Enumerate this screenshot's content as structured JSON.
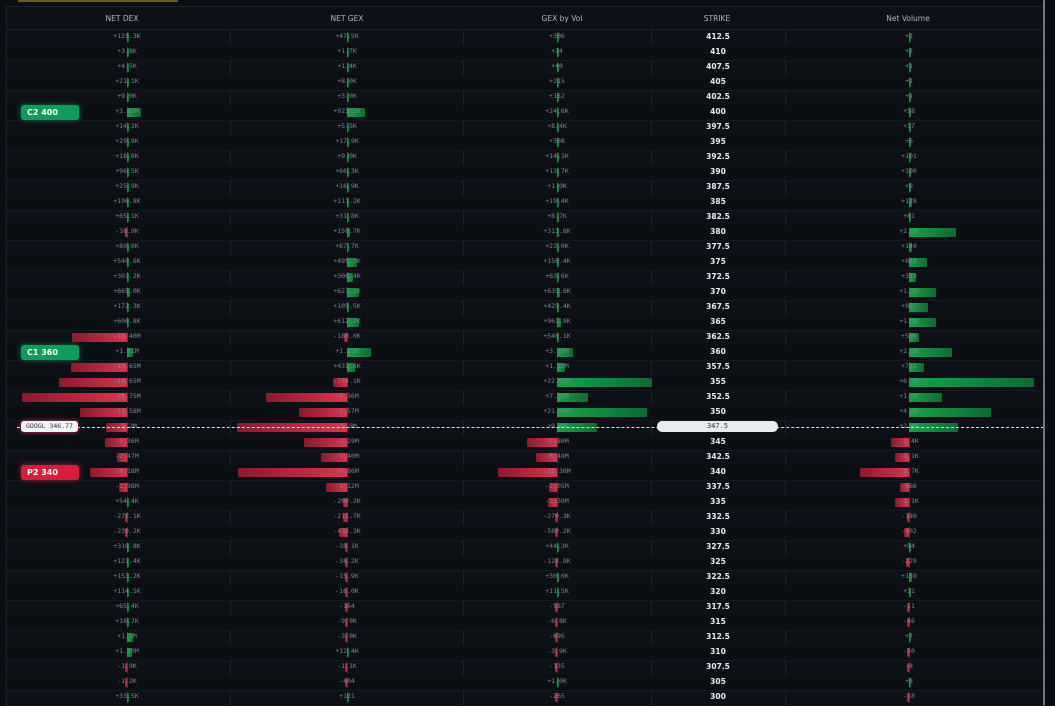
{
  "columns": [
    {
      "key": "dex",
      "label": "NET DEX"
    },
    {
      "key": "gex",
      "label": "NET GEX"
    },
    {
      "key": "gexvol",
      "label": "GEX by Vol"
    },
    {
      "key": "strike",
      "label": "STRIKE"
    },
    {
      "key": "vol",
      "label": "Net Volume"
    }
  ],
  "rows": [
    {
      "strike": "412.5",
      "dex": "+125.3K",
      "gex": "+47.5K",
      "gexvol": "+306",
      "vol": "+2"
    },
    {
      "strike": "410",
      "dex": "+3.8K",
      "gex": "+1.7K",
      "gexvol": "+24",
      "vol": "+2"
    },
    {
      "strike": "407.5",
      "dex": "+4.5K",
      "gex": "+1.4K",
      "gexvol": "+40",
      "vol": "+1"
    },
    {
      "strike": "405",
      "dex": "+21.1K",
      "gex": "+8.0K",
      "gexvol": "+215",
      "vol": "+1"
    },
    {
      "strike": "402.5",
      "dex": "+9.0K",
      "gex": "+3.0K",
      "gexvol": "+152",
      "vol": "+1"
    },
    {
      "strike": "400",
      "dex": "+3.65M",
      "gex": "+923.5K",
      "gexvol": "+24.6K",
      "vol": "+58"
    },
    {
      "strike": "397.5",
      "dex": "+14.3K",
      "gex": "+5.5K",
      "gexvol": "+8.4K",
      "vol": "+37"
    },
    {
      "strike": "395",
      "dex": "+29.9K",
      "gex": "+17.9K",
      "gexvol": "+308",
      "vol": "+6"
    },
    {
      "strike": "392.5",
      "dex": "+18.6K",
      "gex": "+9.0K",
      "gexvol": "+14.1K",
      "vol": "+101"
    },
    {
      "strike": "390",
      "dex": "+96.5K",
      "gex": "+66.3K",
      "gexvol": "+13.7K",
      "vol": "+100"
    },
    {
      "strike": "387.5",
      "dex": "+25.9K",
      "gex": "+16.9K",
      "gexvol": "+1.0K",
      "vol": "+9"
    },
    {
      "strike": "385",
      "dex": "+196.8K",
      "gex": "+111.2K",
      "gexvol": "+19.4K",
      "vol": "+128"
    },
    {
      "strike": "382.5",
      "dex": "+65.1K",
      "gex": "+31.8K",
      "gexvol": "+8.7K",
      "vol": "+81"
    },
    {
      "strike": "380",
      "dex": "-38.9K",
      "gex": "+150.7K",
      "gexvol": "+313.8K",
      "vol": "+2.3K"
    },
    {
      "strike": "377.5",
      "dex": "+80.0K",
      "gex": "+67.7K",
      "gexvol": "+23.0K",
      "vol": "+140"
    },
    {
      "strike": "375",
      "dex": "+540.6K",
      "gex": "+495.3K",
      "gexvol": "+150.4K",
      "vol": "+854"
    },
    {
      "strike": "372.5",
      "dex": "+301.2K",
      "gex": "+300.4K",
      "gexvol": "+63.6K",
      "vol": "+319"
    },
    {
      "strike": "370",
      "dex": "+665.0K",
      "gex": "+627.3K",
      "gexvol": "+635.6K",
      "vol": "+1.3K"
    },
    {
      "strike": "367.5",
      "dex": "+172.3K",
      "gex": "+105.5K",
      "gexvol": "+425.4K",
      "vol": "+937"
    },
    {
      "strike": "365",
      "dex": "+600.8K",
      "gex": "+612.7K",
      "gexvol": "+961.8K",
      "vol": "+1.3K"
    },
    {
      "strike": "362.5",
      "dex": "-13.40M",
      "gex": "-180.0K",
      "gexvol": "+546.1K",
      "vol": "+508"
    },
    {
      "strike": "360",
      "dex": "+1.51M",
      "gex": "+1.23M",
      "gexvol": "+3.70M",
      "vol": "+2.1K"
    },
    {
      "strike": "357.5",
      "dex": "-13.65M",
      "gex": "+431.6K",
      "gexvol": "+1.92M",
      "vol": "+751"
    },
    {
      "strike": "355",
      "dex": "-16.65M",
      "gex": "-774.1K",
      "gexvol": "+22.05M",
      "vol": "+6.1K"
    },
    {
      "strike": "352.5",
      "dex": "-25.75M",
      "gex": "-4.36M",
      "gexvol": "+7.30M",
      "vol": "+1.6K"
    },
    {
      "strike": "350",
      "dex": "-11.58M",
      "gex": "-2.57M",
      "gexvol": "+21.00M",
      "vol": "+4.0K"
    },
    {
      "strike": "347.5",
      "dex": "-5.2M",
      "gex": "-5.9M",
      "gexvol": "+9.4M",
      "vol": "+2.4K"
    },
    {
      "strike": "345",
      "dex": "-5.36M",
      "gex": "-2.29M",
      "gexvol": "-7.80M",
      "vol": "-1.4K"
    },
    {
      "strike": "342.5",
      "dex": "-2.47M",
      "gex": "-1.40M",
      "gexvol": "-5.48M",
      "vol": "-1.1K"
    },
    {
      "strike": "340",
      "dex": "-9.18M",
      "gex": "-5.86M",
      "gexvol": "-15.30M",
      "vol": "-3.7K"
    },
    {
      "strike": "337.5",
      "dex": "-1.98M",
      "gex": "-1.12M",
      "gexvol": "-2.05M",
      "vol": "-666"
    },
    {
      "strike": "335",
      "dex": "+54.4K",
      "gex": "-209.2K",
      "gexvol": "-2.30M",
      "vol": "-1.1K"
    },
    {
      "strike": "332.5",
      "dex": "-272.1K",
      "gex": "-211.7K",
      "gexvol": "-270.3K",
      "vol": "-189"
    },
    {
      "strike": "330",
      "dex": "-239.2K",
      "gex": "-433.3K",
      "gexvol": "-580.2K",
      "vol": "-402"
    },
    {
      "strike": "327.5",
      "dex": "+310.8K",
      "gex": "-38.1K",
      "gexvol": "+44.3K",
      "vol": "+94"
    },
    {
      "strike": "325",
      "dex": "+121.4K",
      "gex": "-38.2K",
      "gexvol": "-128.8K",
      "vol": "-229"
    },
    {
      "strike": "322.5",
      "dex": "+153.2K",
      "gex": "-15.9K",
      "gexvol": "+30.0K",
      "vol": "+159"
    },
    {
      "strike": "320",
      "dex": "+114.5K",
      "gex": "-16.0K",
      "gexvol": "+11.5K",
      "vol": "+31"
    },
    {
      "strike": "317.5",
      "dex": "+65.4K",
      "gex": "-164",
      "gexvol": "-587",
      "vol": "-11"
    },
    {
      "strike": "315",
      "dex": "+18.7K",
      "gex": "-9.9K",
      "gexvol": "-6.8K",
      "vol": "-46"
    },
    {
      "strike": "312.5",
      "dex": "+1.5M",
      "gex": "-3.0K",
      "gexvol": "-695",
      "vol": "+7"
    },
    {
      "strike": "310",
      "dex": "+1.20M",
      "gex": "+12.4K",
      "gexvol": "-3.9K",
      "vol": "-50"
    },
    {
      "strike": "307.5",
      "dex": "-1.9K",
      "gex": "-1.1K",
      "gexvol": "-135",
      "vol": "-8"
    },
    {
      "strike": "305",
      "dex": "-1.2K",
      "gex": "-404",
      "gexvol": "+1.0K",
      "vol": "+8"
    },
    {
      "strike": "300",
      "dex": "+33.5K",
      "gex": "+121",
      "gexvol": "-265",
      "vol": "-18"
    }
  ],
  "badges": [
    {
      "label": "C2 400",
      "type": "call",
      "strike": "400"
    },
    {
      "label": "C1 360",
      "type": "call",
      "strike": "360"
    },
    {
      "label": "P2 340",
      "type": "put",
      "strike": "340"
    }
  ],
  "spot": {
    "label": "GOOGL 346.77",
    "strike_label": "347.5"
  }
}
